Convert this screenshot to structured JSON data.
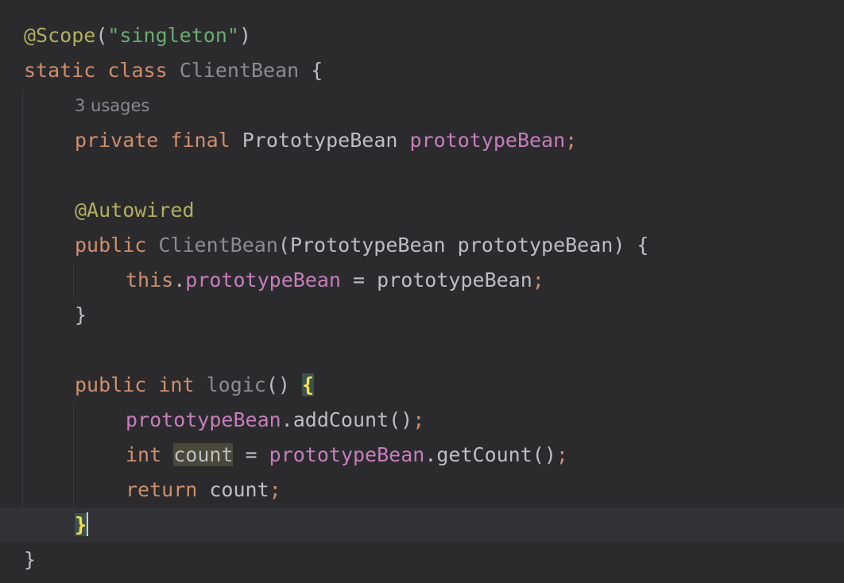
{
  "editor": {
    "lines": {
      "scope_annotation": "@Scope",
      "scope_open_paren": "(",
      "scope_value": "\"singleton\"",
      "scope_close_paren": ")",
      "kw_static": "static",
      "kw_class": "class",
      "class_name": "ClientBean",
      "class_open_brace": "{",
      "usages_hint": "3 usages",
      "kw_private": "private",
      "kw_final": "final",
      "field_type": "PrototypeBean",
      "field_name": "prototypeBean",
      "field_semicolon": ";",
      "autowired_annotation": "@Autowired",
      "ctor_kw_public": "public",
      "ctor_name": "ClientBean",
      "ctor_params": "(PrototypeBean prototypeBean) {",
      "ctor_this": "this",
      "ctor_dot": ".",
      "ctor_field": "prototypeBean",
      "ctor_assign": " = prototypeBean",
      "ctor_semicolon": ";",
      "ctor_close_brace": "}",
      "method_kw_public": "public",
      "method_kw_int": "int",
      "method_name": "logic",
      "method_parens": "() ",
      "method_open_brace": "{",
      "stmt1_receiver": "prototypeBean",
      "stmt1_call": ".addCount()",
      "stmt1_semicolon": ";",
      "stmt2_kw_int": "int",
      "stmt2_var": "count",
      "stmt2_assign": " = ",
      "stmt2_receiver": "prototypeBean",
      "stmt2_call": ".getCount()",
      "stmt2_semicolon": ";",
      "stmt3_kw_return": "return",
      "stmt3_var": " count",
      "stmt3_semicolon": ";",
      "method_close_brace": "}",
      "class_close_brace": "}"
    }
  },
  "colors": {
    "background": "#2b2b2d",
    "current_line": "#313235",
    "keyword": "#cf8e6d",
    "annotation": "#b3ae60",
    "string": "#6aab73",
    "field": "#c77dbb",
    "identifier": "#bcbec4",
    "hint": "#868a91",
    "brace_match": "#f2e05a"
  }
}
